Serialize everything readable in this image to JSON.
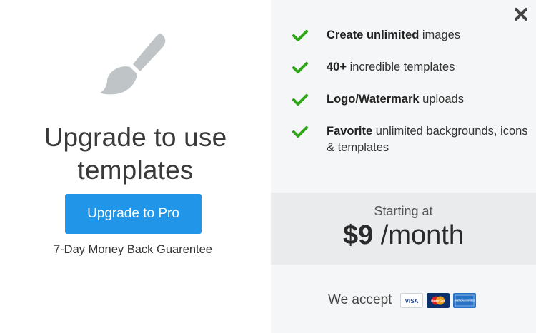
{
  "left": {
    "title": "Upgrade to use templates",
    "cta_label": "Upgrade to Pro",
    "guarantee": "7-Day Money Back Guarentee"
  },
  "right": {
    "features": [
      {
        "bold": "Create unlimited",
        "rest": " images"
      },
      {
        "bold": "40+",
        "rest": " incredible templates"
      },
      {
        "bold": "Logo/Watermark",
        "rest": " uploads"
      },
      {
        "bold": "Favorite",
        "rest": " unlimited backgrounds, icons & templates"
      }
    ],
    "pricing": {
      "starting_label": "Starting at",
      "amount": "$9",
      "period": " /month"
    },
    "accept_label": "We accept",
    "cards": [
      {
        "name": "VISA",
        "icon": "visa-card-icon"
      },
      {
        "name": "MasterCard",
        "icon": "mastercard-icon"
      },
      {
        "name": "AMERICAN EXPRESS",
        "icon": "amex-card-icon"
      }
    ]
  },
  "colors": {
    "cta": "#2196e9",
    "check": "#2fa51a",
    "brush": "#bfc4c7",
    "right_bg": "#f5f6f7",
    "pricing_bg": "#e9ebed"
  }
}
